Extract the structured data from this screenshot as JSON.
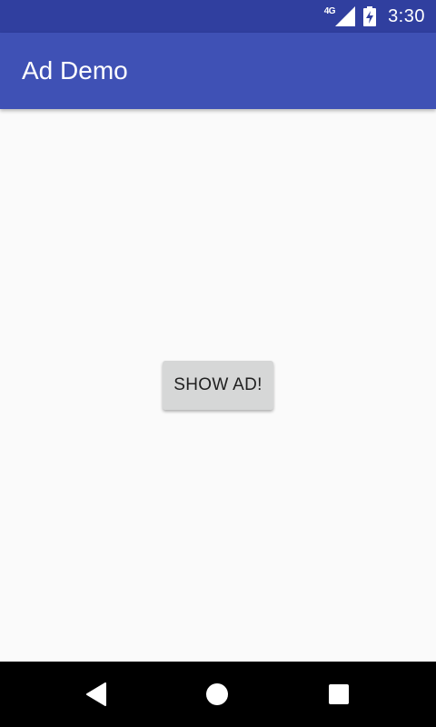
{
  "status_bar": {
    "network_label": "4G",
    "time": "3:30",
    "icons": [
      "signal-icon",
      "battery-charging-icon"
    ]
  },
  "app_bar": {
    "title": "Ad Demo"
  },
  "main": {
    "show_ad_label": "SHOW AD!"
  },
  "nav_bar": {
    "icons": [
      "back-icon",
      "home-icon",
      "recents-icon"
    ]
  },
  "colors": {
    "status_bar": "#303f9f",
    "app_bar": "#3f51b5",
    "background": "#fafafa",
    "button": "#d6d7d7",
    "nav_bar": "#000000"
  }
}
